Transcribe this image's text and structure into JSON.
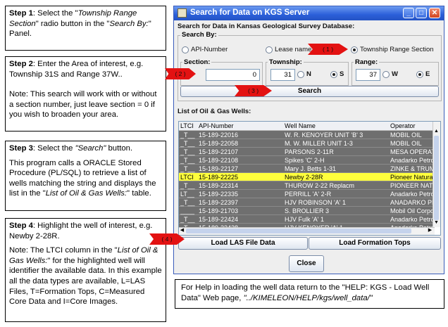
{
  "steps": {
    "step1": {
      "label": "Step 1",
      "pre": ": Select the \"",
      "q1": "Township Range Section",
      "mid": "\" radio button in the \"",
      "q2": "Search By:",
      "post": "\" Panel."
    },
    "step2": {
      "label": "Step 2",
      "line1": ": Enter the Area of interest, e.g. Township 31S and Range 37W..",
      "note": "Note: This search will work with or without a section number, just leave section = 0 if you wish to broaden your area."
    },
    "step3": {
      "label": "Step 3",
      "line1_pre": ": Select the ",
      "line1_q": "\"Search\"",
      "line1_post": " button.",
      "body_pre": "This program calls a ORACLE Stored Procedure (PL/SQL) to retrieve a list of wells matching the string and displays the list in the \"",
      "body_q": "List of Oil & Gas Wells:",
      "body_post": "\" table."
    },
    "step4": {
      "label": "Step 4",
      "line1": ": Highlight the well of interest, e.g. Newby 2-28R.",
      "note_pre": "Note: The LTCI column in the \"",
      "note_q": "List of Oil & Gas Wells:",
      "note_post": "\" for the highlighted well will identifier the available data. In this example all the data types are available, L=LAS Files, T=Formation Tops, C=Measured Core Data and I=Core Images."
    }
  },
  "help": {
    "text": "For Help in loading the well data return to the \"HELP: KGS - Load Well Data\" Web page, ",
    "path": "\"../KIMELEON/HELP/kgs/well_data/\""
  },
  "window": {
    "title": "Search for Data on KGS Server",
    "subtitle": "Search for Data in Kansas Geological Survey Database:",
    "search_by": "Search By:",
    "api_radio": "API-Number",
    "lease_radio": "Lease name",
    "trs_radio": "Township Range Section",
    "section_label": "Section:",
    "section_value": "0",
    "township_label": "Township:",
    "township_value": "31",
    "n_label": "N",
    "s_label": "S",
    "range_label": "Range:",
    "range_value": "37",
    "w_label": "W",
    "e_label": "E",
    "search_button": "Search",
    "list_label": "List of Oil & Gas Wells:",
    "columns": [
      "LTCI",
      "API-Number",
      "Well Name",
      "Operator"
    ],
    "rows": [
      {
        "ltci": "_T__",
        "api": "15-189-22016",
        "name": "W. R. KENOYER UNIT 'B' 3",
        "op": "MOBIL OIL",
        "sel": false
      },
      {
        "ltci": "_T__",
        "api": "15-189-22058",
        "name": "M. W. MILLER UNIT 1-3",
        "op": "MOBIL OIL",
        "sel": false
      },
      {
        "ltci": "_T__",
        "api": "15-189-22107",
        "name": "PARSONS 2-11R",
        "op": "MESA OPERATING",
        "sel": false
      },
      {
        "ltci": "_T__",
        "api": "15-189-22108",
        "name": "Spikes 'C' 2-H",
        "op": "Anadarko Petroleum Co",
        "sel": false
      },
      {
        "ltci": "_T__",
        "api": "15-189-22127",
        "name": "Mary J. Betts 1-31",
        "op": "ZINKE & TRUMBO, INC",
        "sel": false
      },
      {
        "ltci": "LTCI",
        "api": "15-189-22225",
        "name": "Newby 2-28R",
        "op": "Pioneer Natural Resou",
        "sel": true
      },
      {
        "ltci": "_T__",
        "api": "15-189-22314",
        "name": "THUROW 2-22 Replacm",
        "op": "PIONEER NATURAL RE",
        "sel": false
      },
      {
        "ltci": "LT__",
        "api": "15-189-22335",
        "name": "PERRILL 'A' 2-R",
        "op": "Anadarko Petroleum Co",
        "sel": false
      },
      {
        "ltci": "_T__",
        "api": "15-189-22397",
        "name": "HJV ROBINSON 'A' 1",
        "op": "ANADARKO PETROLEU",
        "sel": false
      },
      {
        "ltci": "____",
        "api": "15-189-21703",
        "name": "S. BROLLIER 3",
        "op": "Mobil Oil Corporation",
        "sel": false
      },
      {
        "ltci": "_T__",
        "api": "15-189-22424",
        "name": "HJV Fulk 'A' 1",
        "op": "Anadarko Petroleum Co",
        "sel": false
      },
      {
        "ltci": "_T__",
        "api": "15-189-22428",
        "name": "HJV KENOYER 'A' 1",
        "op": "Anadarko Petroleum Co",
        "sel": false
      }
    ],
    "load_las": "Load LAS File Data",
    "load_tops": "Load Formation Tops",
    "close": "Close"
  },
  "arrows": [
    "( 1 )",
    "( 2 )",
    "( 3 )",
    "( 4 )"
  ],
  "colors": {
    "title_bar": "#2b5fd9",
    "selected_row": "#ffff3c",
    "row_bg": "#6f6f6f",
    "arrow": "#e31212"
  }
}
